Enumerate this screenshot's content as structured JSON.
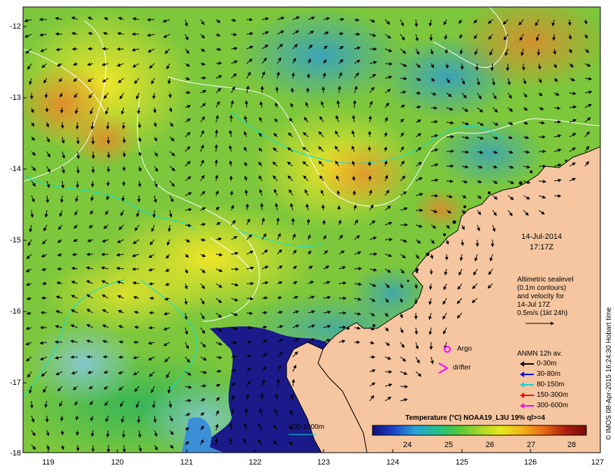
{
  "map": {
    "lat_ticks": [
      "-12",
      "-13",
      "-14",
      "-15",
      "-16",
      "-17",
      "-18"
    ],
    "lon_ticks": [
      "119",
      "120",
      "121",
      "122",
      "123",
      "124",
      "125",
      "126",
      "127"
    ]
  },
  "date_label": {
    "date": "14-Jul-2014",
    "time": "17:17Z"
  },
  "annotation": {
    "lines": [
      "Altimetric sealevel",
      "(0.1m contours)",
      "and velocity for",
      "14-Jul 17Z",
      "0.5m/s (1kt 24h)"
    ]
  },
  "legend": {
    "argo": "Argo",
    "drifter": "drifter",
    "anmn_title": "ANMN 12h av.",
    "items": [
      {
        "label": "0-30m",
        "color": "#000000"
      },
      {
        "label": "30-80m",
        "color": "#0000ff"
      },
      {
        "label": "80-150m",
        "color": "#00d8d8"
      },
      {
        "label": "150-300m",
        "color": "#ff0000"
      },
      {
        "label": "300-600m",
        "color": "#ff00ff"
      }
    ]
  },
  "isobath_label": "200  1000m",
  "colorbar": {
    "title": "Temperature (°C) NOAA19_L3U 19% ql>=4",
    "ticks": [
      "24",
      "25",
      "26",
      "27",
      "28"
    ],
    "colors": [
      "#10107a",
      "#1b45c8",
      "#2aa4d6",
      "#1fc08c",
      "#50c83a",
      "#a6d82a",
      "#e8e81a",
      "#f4b21a",
      "#e86a14",
      "#b02010",
      "#7a0a06"
    ]
  },
  "credit": "© IMOS 08-Apr-2015 16:24:30 Hobart time",
  "colors": {
    "land": "#f5c6a0",
    "coast": "#000000"
  }
}
